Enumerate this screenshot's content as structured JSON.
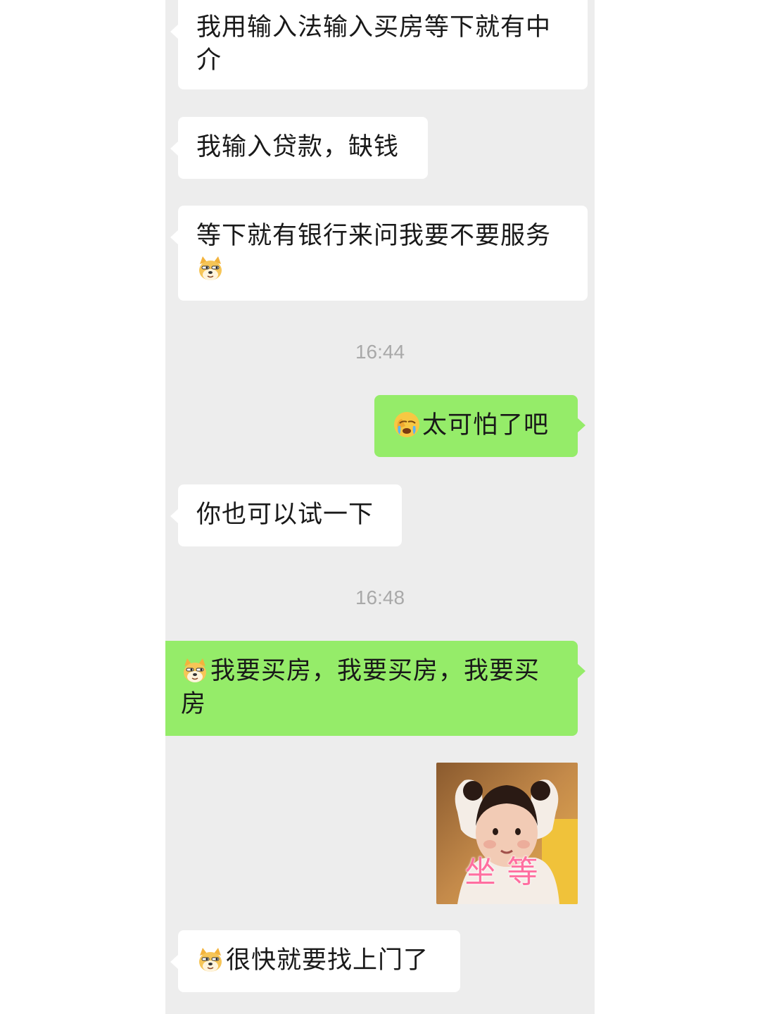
{
  "messages": [
    {
      "side": "in",
      "text": "我用输入法输入买房等下就有中介"
    },
    {
      "side": "in",
      "text": "我输入贷款，缺钱"
    },
    {
      "side": "in",
      "text": "等下就有银行来问我要不要服务",
      "trailing_emoji": "doge-emoji"
    },
    {
      "time": "16:44"
    },
    {
      "side": "out",
      "leading_emoji": "facepalm-cry-emoji",
      "text": "太可怕了吧"
    },
    {
      "side": "in",
      "text": "你也可以试一下"
    },
    {
      "time": "16:48"
    },
    {
      "side": "out",
      "leading_emoji": "doge-emoji",
      "text": "我要买房，我要买房，我要买房"
    },
    {
      "side": "out",
      "sticker": "baby-sitting-waiting-sticker",
      "caption": "坐等"
    },
    {
      "side": "in",
      "leading_emoji": "doge-emoji",
      "text": "很快就要找上门了"
    }
  ],
  "colors": {
    "chat_background": "#ededed",
    "incoming_bubble": "#ffffff",
    "outgoing_bubble": "#95ec69",
    "timestamp_text": "#a9a9a9"
  }
}
